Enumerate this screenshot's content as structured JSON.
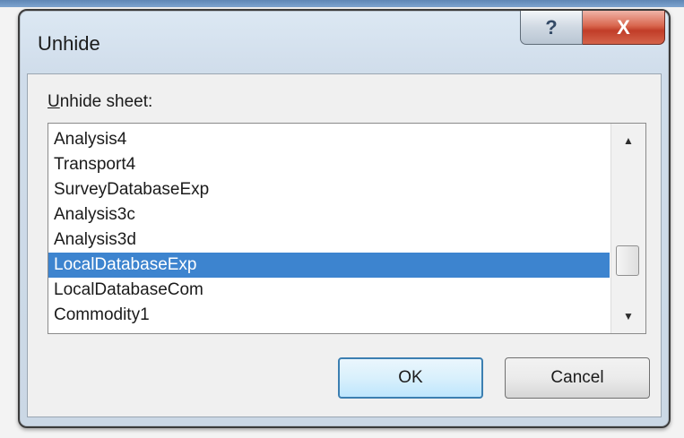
{
  "dialog": {
    "title": "Unhide",
    "help_button": "?",
    "close_button": "X"
  },
  "list": {
    "label_accel": "U",
    "label_rest": "nhide sheet:",
    "items": [
      "Analysis4",
      "Transport4",
      "SurveyDatabaseExp",
      "Analysis3c",
      "Analysis3d",
      "LocalDatabaseExp",
      "LocalDatabaseCom",
      "Commodity1"
    ],
    "selected": "LocalDatabaseExp",
    "scroll_up": "▲",
    "scroll_down": "▼"
  },
  "buttons": {
    "ok": "OK",
    "cancel": "Cancel"
  },
  "colors": {
    "selection": "#3d84cf",
    "close": "#c13d28",
    "default_button_border": "#3c7fb1"
  }
}
